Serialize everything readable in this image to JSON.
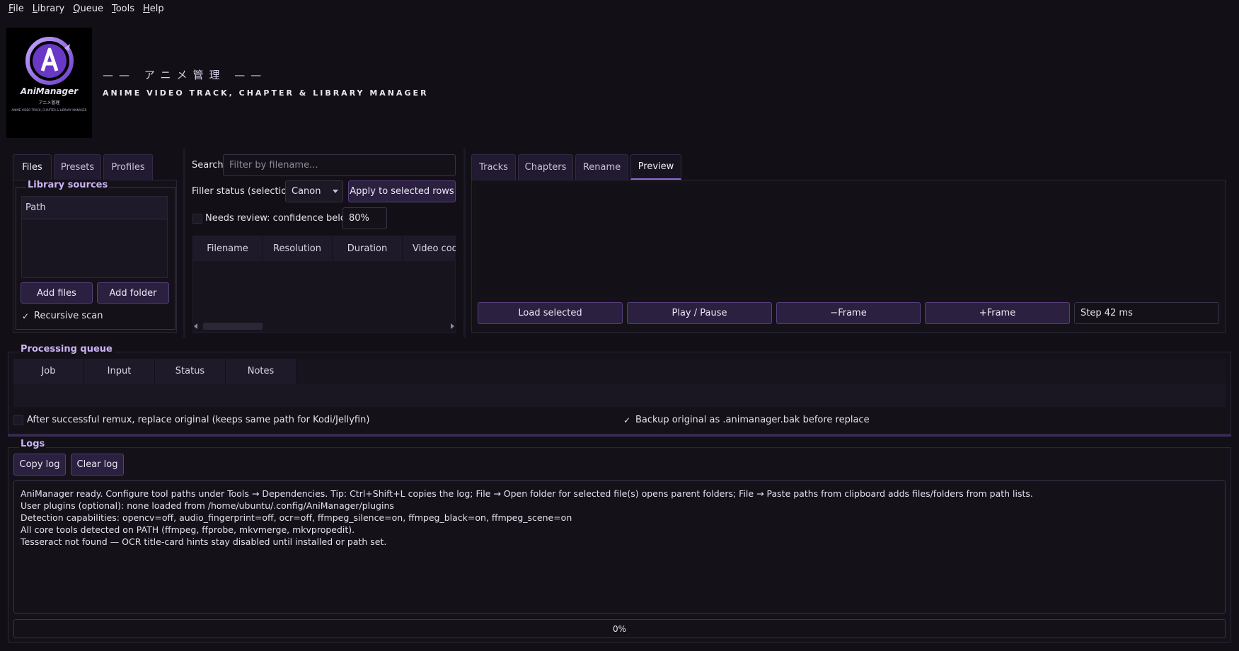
{
  "menubar": [
    "File",
    "Library",
    "Queue",
    "Tools",
    "Help"
  ],
  "header": {
    "logo_brand": "AniManager",
    "logo_sub": "アニメ管理",
    "logo_small": "ANIME VIDEO TRACK, CHAPTER & LIBRARY MANAGER",
    "title": "—— アニメ管理 ——",
    "subtitle": "ANIME VIDEO TRACK, CHAPTER & LIBRARY MANAGER"
  },
  "left_tabs": [
    "Files",
    "Presets",
    "Profiles"
  ],
  "library": {
    "group_title": "Library sources",
    "list_header": "Path",
    "add_files": "Add files",
    "add_folder": "Add folder",
    "recursive_label": "Recursive scan",
    "recursive_checked": true
  },
  "center": {
    "search_label": "Search",
    "search_placeholder": "Filter by filename...",
    "filler_label": "Filler status (selection)",
    "filler_value": "Canon",
    "apply_button": "Apply to selected rows",
    "needs_review_label": "Needs review: confidence below",
    "confidence_value": "80%",
    "columns": [
      "Filename",
      "Resolution",
      "Duration",
      "Video cod"
    ]
  },
  "right_tabs": [
    "Tracks",
    "Chapters",
    "Rename",
    "Preview"
  ],
  "preview": {
    "load_selected": "Load selected",
    "play_pause": "Play / Pause",
    "minus_frame": "−Frame",
    "plus_frame": "+Frame",
    "step_value": "Step 42 ms"
  },
  "queue": {
    "group_title": "Processing queue",
    "columns": [
      "Job",
      "Input",
      "Status",
      "Notes"
    ],
    "replace_label": "After successful remux, replace original (keeps same path for Kodi/Jellyfin)",
    "backup_label": "Backup original as .animanager.bak before replace",
    "backup_checked": true
  },
  "logs": {
    "group_title": "Logs",
    "copy_log": "Copy log",
    "clear_log": "Clear log",
    "lines": [
      "AniManager ready. Configure tool paths under Tools → Dependencies. Tip: Ctrl+Shift+L copies the log; File → Open folder for selected file(s) opens parent folders; File → Paste paths from clipboard adds files/folders from path lists.",
      "User plugins (optional): none loaded from /home/ubuntu/.config/AniManager/plugins",
      "Detection capabilities: opencv=off, audio_fingerprint=off, ocr=off, ffmpeg_silence=on, ffmpeg_black=on, ffmpeg_scene=on",
      "All core tools detected on PATH (ffmpeg, ffprobe, mkvmerge, mkvpropedit).",
      "Tesseract not found — OCR title-card hints stay disabled until installed or path set."
    ]
  },
  "progress": {
    "value": 0,
    "text": "0%"
  },
  "colors": {
    "background": "#121016",
    "accent": "#8a6ad0",
    "button": "#2b2040",
    "group_title": "#cbb2f5"
  }
}
